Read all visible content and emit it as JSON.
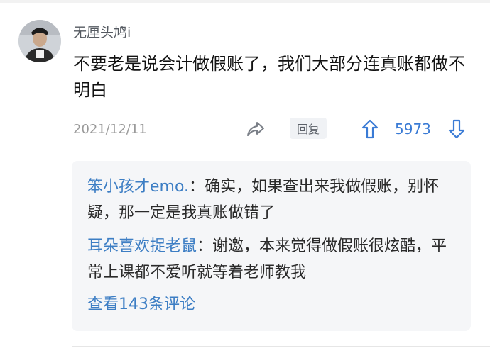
{
  "comment": {
    "username": "无厘头鸠i",
    "content": "不要老是说会计做假账了，我们大部分连真账都做不明白",
    "date": "2021/12/11",
    "reply_label": "回复",
    "vote_count": "5973"
  },
  "replies": [
    {
      "author": "笨小孩才emo.",
      "separator": "：",
      "text": "确实，如果查出来我做假账，别怀疑，那一定是我真账做错了"
    },
    {
      "author": "耳朵喜欢捉老鼠",
      "separator": "：",
      "text": "谢邀，本来觉得做假账很炫酷，平常上课都不爱听就等着老师教我"
    }
  ],
  "view_more_label": "查看143条评论",
  "colors": {
    "accent_blue": "#3d7ec4",
    "vote_blue": "#3a7bd5",
    "muted_text": "#9a9a9a",
    "reply_bg": "#f5f6f8"
  },
  "icons": {
    "share": "share-icon",
    "upvote": "arrow-up-icon",
    "downvote": "arrow-down-icon"
  }
}
